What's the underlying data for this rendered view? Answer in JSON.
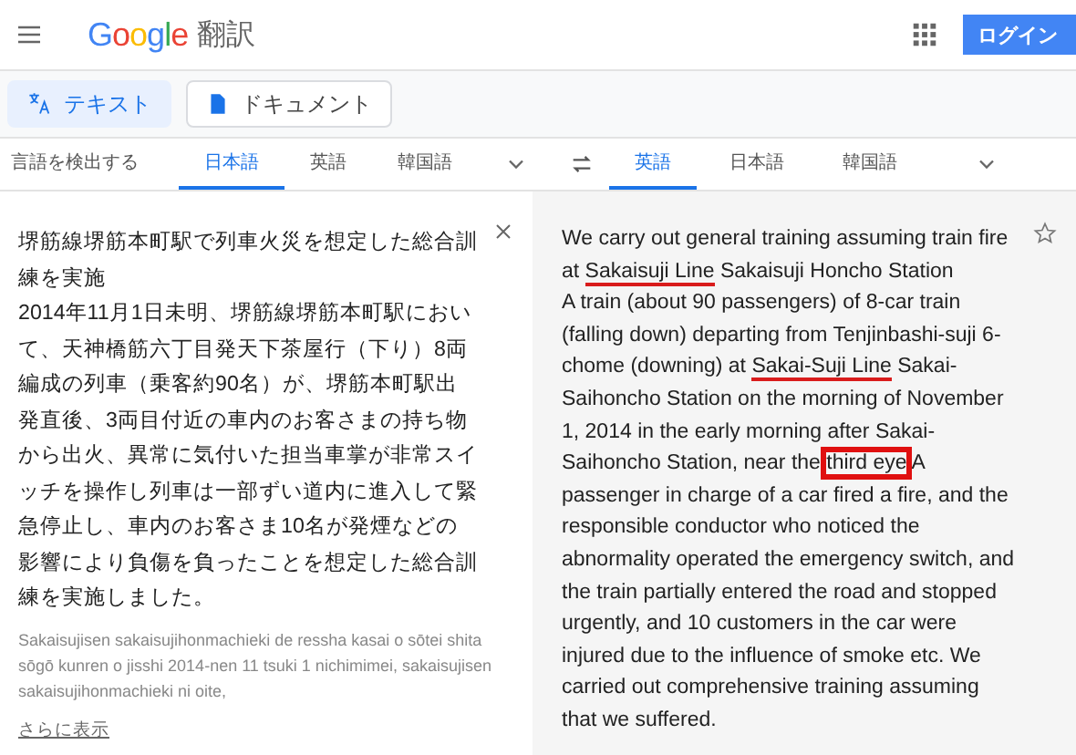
{
  "header": {
    "logo": "Google",
    "title": "翻訳",
    "login": "ログイン"
  },
  "modes": [
    {
      "label": "テキスト",
      "kind": "text",
      "selected": true
    },
    {
      "label": "ドキュメント",
      "kind": "document",
      "selected": false
    }
  ],
  "source_langs": [
    {
      "label": "言語を検出する",
      "selected": false
    },
    {
      "label": "日本語",
      "selected": true
    },
    {
      "label": "英語",
      "selected": false
    },
    {
      "label": "韓国語",
      "selected": false
    }
  ],
  "target_langs": [
    {
      "label": "英語",
      "selected": true
    },
    {
      "label": "日本語",
      "selected": false
    },
    {
      "label": "韓国語",
      "selected": false
    }
  ],
  "source": {
    "paragraphs": [
      "堺筋線堺筋本町駅で列車火災を想定した総合訓練を実施",
      "2014年11月1日未明、堺筋線堺筋本町駅において、天神橋筋六丁目発天下茶屋行（下り）8両編成の列車（乗客約90名）が、堺筋本町駅出発直後、3両目付近の車内のお客さまの持ち物から出火、異常に気付いた担当車掌が非常スイッチを操作し列車は一部ずい道内に進入して緊急停止し、車内のお客さま10名が発煙などの影響により負傷を負ったことを想定した総合訓練を実施しました。"
    ],
    "romanization": "Sakaisujisen sakaisujihonmachieki de ressha kasai o sōtei shita sōgō kunren o jisshi 2014-nen 11 tsuki 1 nichimimei, sakaisujisen sakaisujihonmachieki ni oite,",
    "more": "さらに表示"
  },
  "translation": {
    "paragraphs": [
      [
        {
          "text": "We carry out general training assuming train fire at ",
          "kind": "plain"
        },
        {
          "text": "Sakaisuji Line",
          "kind": "underline"
        },
        {
          "text": " Sakaisuji Honcho Station",
          "kind": "plain"
        }
      ],
      [
        {
          "text": "A train (about 90 passengers) of 8-car train (falling down) departing from Tenjinbashi-suji 6-chome (downing) at ",
          "kind": "plain"
        },
        {
          "text": "Sakai-Suji Line",
          "kind": "underline"
        },
        {
          "text": " Sakai-Saihoncho Station on the morning of November 1, 2014 in the early morning after Sakai-Saihoncho Station, near the ",
          "kind": "plain"
        },
        {
          "text": "third eye",
          "kind": "box"
        },
        {
          "text": " A passenger in charge of a car fired a fire, and the responsible conductor who noticed the abnormality operated the emergency switch, and the train partially entered the road and stopped urgently, and 10 customers in the car were injured due to the influence of smoke etc. We carried out comprehensive training assuming that we suffered.",
          "kind": "plain"
        }
      ]
    ]
  }
}
